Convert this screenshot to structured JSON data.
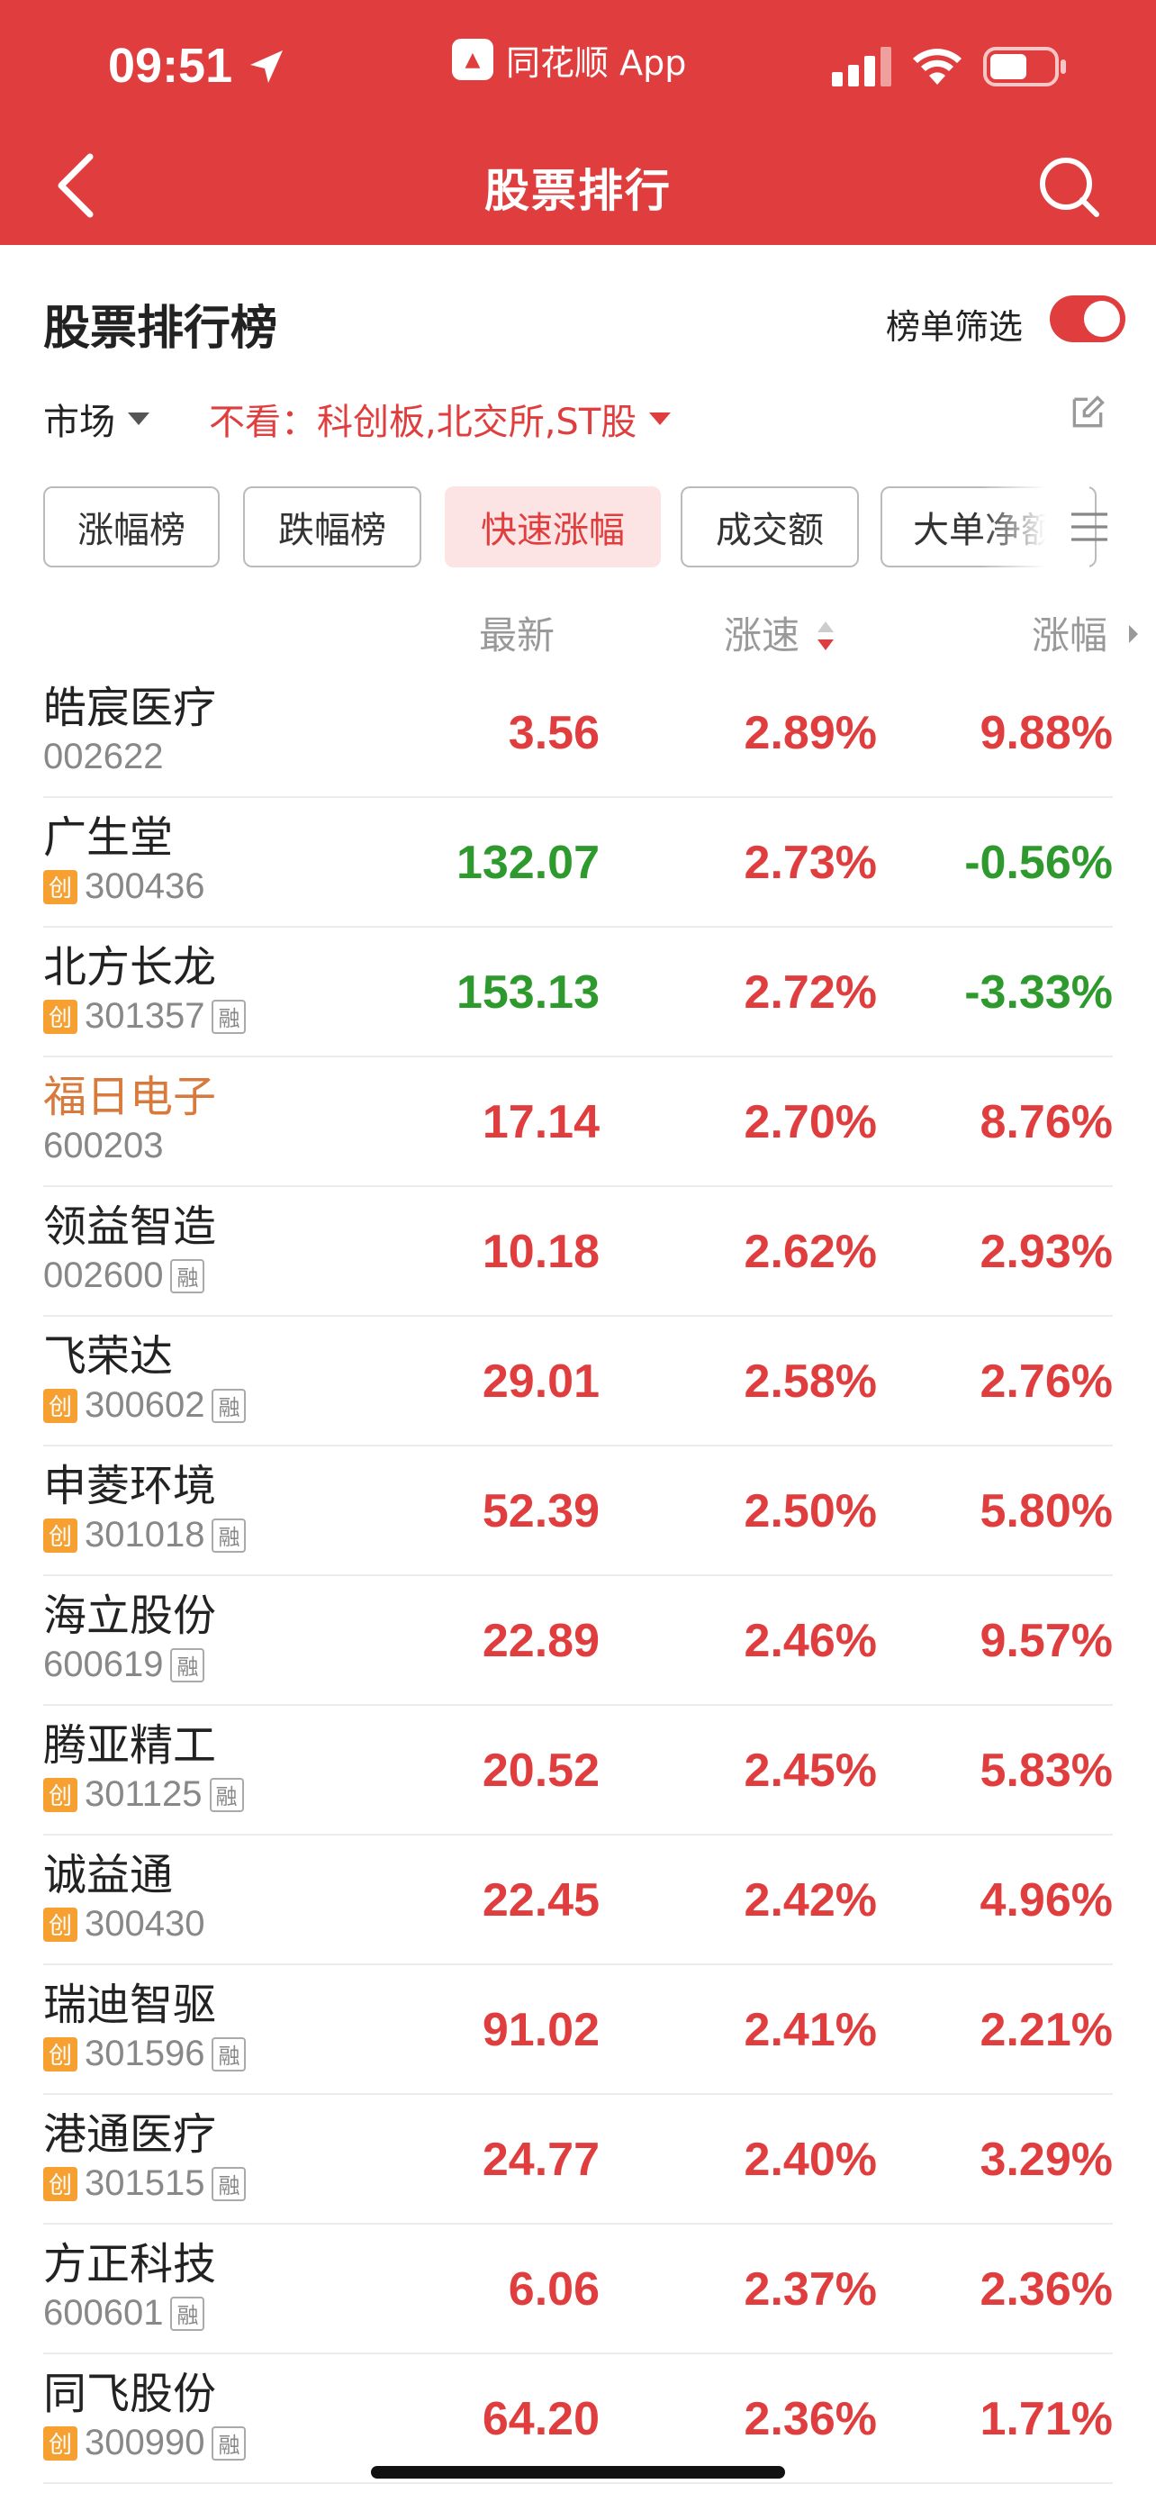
{
  "status_bar": {
    "time": "09:51",
    "app_name": "同花顺 App"
  },
  "nav": {
    "title": "股票排行"
  },
  "section": {
    "title": "股票排行榜",
    "filter_label": "榜单筛选",
    "filter_on": true
  },
  "filters": {
    "market_label": "市场",
    "exclude_label": "不看：科创板,北交所,ST股"
  },
  "tabs": [
    {
      "label": "涨幅榜",
      "active": false
    },
    {
      "label": "跌幅榜",
      "active": false
    },
    {
      "label": "快速涨幅",
      "active": true
    },
    {
      "label": "成交额",
      "active": false
    },
    {
      "label": "大单净额",
      "active": false
    }
  ],
  "columns": {
    "price": "最新",
    "speed": "涨速",
    "change": "涨幅"
  },
  "colors": {
    "up": "#e03e3e",
    "down": "#2e9a2e",
    "header": "#e03e3e",
    "highlight": "#d87a3c"
  },
  "rows": [
    {
      "name": "皓宸医疗",
      "code": "002622",
      "cy": false,
      "rz": false,
      "price": "3.56",
      "speed": "2.89%",
      "change": "9.88%",
      "price_up": true,
      "change_up": true
    },
    {
      "name": "广生堂",
      "code": "300436",
      "cy": true,
      "rz": false,
      "price": "132.07",
      "speed": "2.73%",
      "change": "-0.56%",
      "price_up": false,
      "change_up": false
    },
    {
      "name": "北方长龙",
      "code": "301357",
      "cy": true,
      "rz": true,
      "price": "153.13",
      "speed": "2.72%",
      "change": "-3.33%",
      "price_up": false,
      "change_up": false
    },
    {
      "name": "福日电子",
      "code": "600203",
      "cy": false,
      "rz": false,
      "highlight": true,
      "price": "17.14",
      "speed": "2.70%",
      "change": "8.76%",
      "price_up": true,
      "change_up": true
    },
    {
      "name": "领益智造",
      "code": "002600",
      "cy": false,
      "rz": true,
      "price": "10.18",
      "speed": "2.62%",
      "change": "2.93%",
      "price_up": true,
      "change_up": true
    },
    {
      "name": "飞荣达",
      "code": "300602",
      "cy": true,
      "rz": true,
      "price": "29.01",
      "speed": "2.58%",
      "change": "2.76%",
      "price_up": true,
      "change_up": true
    },
    {
      "name": "申菱环境",
      "code": "301018",
      "cy": true,
      "rz": true,
      "price": "52.39",
      "speed": "2.50%",
      "change": "5.80%",
      "price_up": true,
      "change_up": true
    },
    {
      "name": "海立股份",
      "code": "600619",
      "cy": false,
      "rz": true,
      "price": "22.89",
      "speed": "2.46%",
      "change": "9.57%",
      "price_up": true,
      "change_up": true
    },
    {
      "name": "腾亚精工",
      "code": "301125",
      "cy": true,
      "rz": true,
      "price": "20.52",
      "speed": "2.45%",
      "change": "5.83%",
      "price_up": true,
      "change_up": true
    },
    {
      "name": "诚益通",
      "code": "300430",
      "cy": true,
      "rz": false,
      "price": "22.45",
      "speed": "2.42%",
      "change": "4.96%",
      "price_up": true,
      "change_up": true
    },
    {
      "name": "瑞迪智驱",
      "code": "301596",
      "cy": true,
      "rz": true,
      "price": "91.02",
      "speed": "2.41%",
      "change": "2.21%",
      "price_up": true,
      "change_up": true
    },
    {
      "name": "港通医疗",
      "code": "301515",
      "cy": true,
      "rz": true,
      "price": "24.77",
      "speed": "2.40%",
      "change": "3.29%",
      "price_up": true,
      "change_up": true
    },
    {
      "name": "方正科技",
      "code": "600601",
      "cy": false,
      "rz": true,
      "price": "6.06",
      "speed": "2.37%",
      "change": "2.36%",
      "price_up": true,
      "change_up": true
    },
    {
      "name": "同飞股份",
      "code": "300990",
      "cy": true,
      "rz": true,
      "price": "64.20",
      "speed": "2.36%",
      "change": "1.71%",
      "price_up": true,
      "change_up": true
    }
  ],
  "badges": {
    "cy": "创",
    "rz": "融"
  }
}
